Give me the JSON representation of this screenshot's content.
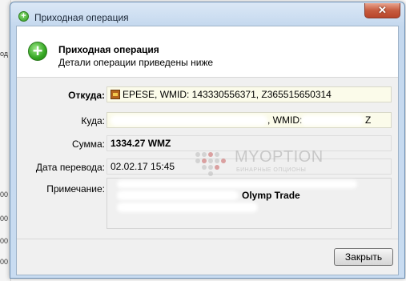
{
  "background": {
    "left_fragment": "од",
    "left_numbers": [
      "00",
      "00",
      "00",
      "00"
    ]
  },
  "window": {
    "title": "Приходная операция",
    "title_icon": "plus-circle-icon",
    "close_glyph": "✕"
  },
  "header": {
    "icon": "plus-circle-icon",
    "title": "Приходная операция",
    "subtitle": "Детали операции приведены ниже"
  },
  "fields": {
    "from": {
      "label": "Откуда:",
      "value": "EPESE, WMID: 143330556371, Z365515650314"
    },
    "to": {
      "label": "Куда:",
      "wmid_label": ", WMID:",
      "suffix": "Z"
    },
    "amount": {
      "label": "Сумма:",
      "value": "1334.27 WMZ"
    },
    "date": {
      "label": "Дата перевода:",
      "value": "02.02.17 15:45"
    },
    "note": {
      "label": "Примечание:",
      "value": "Olymp Trade"
    }
  },
  "watermark": {
    "brand": "MYOPTION",
    "sub": "БИНАРНЫЕ ОПЦИОНЫ"
  },
  "buttons": {
    "close": "Закрыть"
  },
  "colors": {
    "title_bar": "#c4d8ee",
    "close_button": "#c75c3f",
    "field_highlight": "#fbfbea",
    "success_icon": "#34a622"
  }
}
